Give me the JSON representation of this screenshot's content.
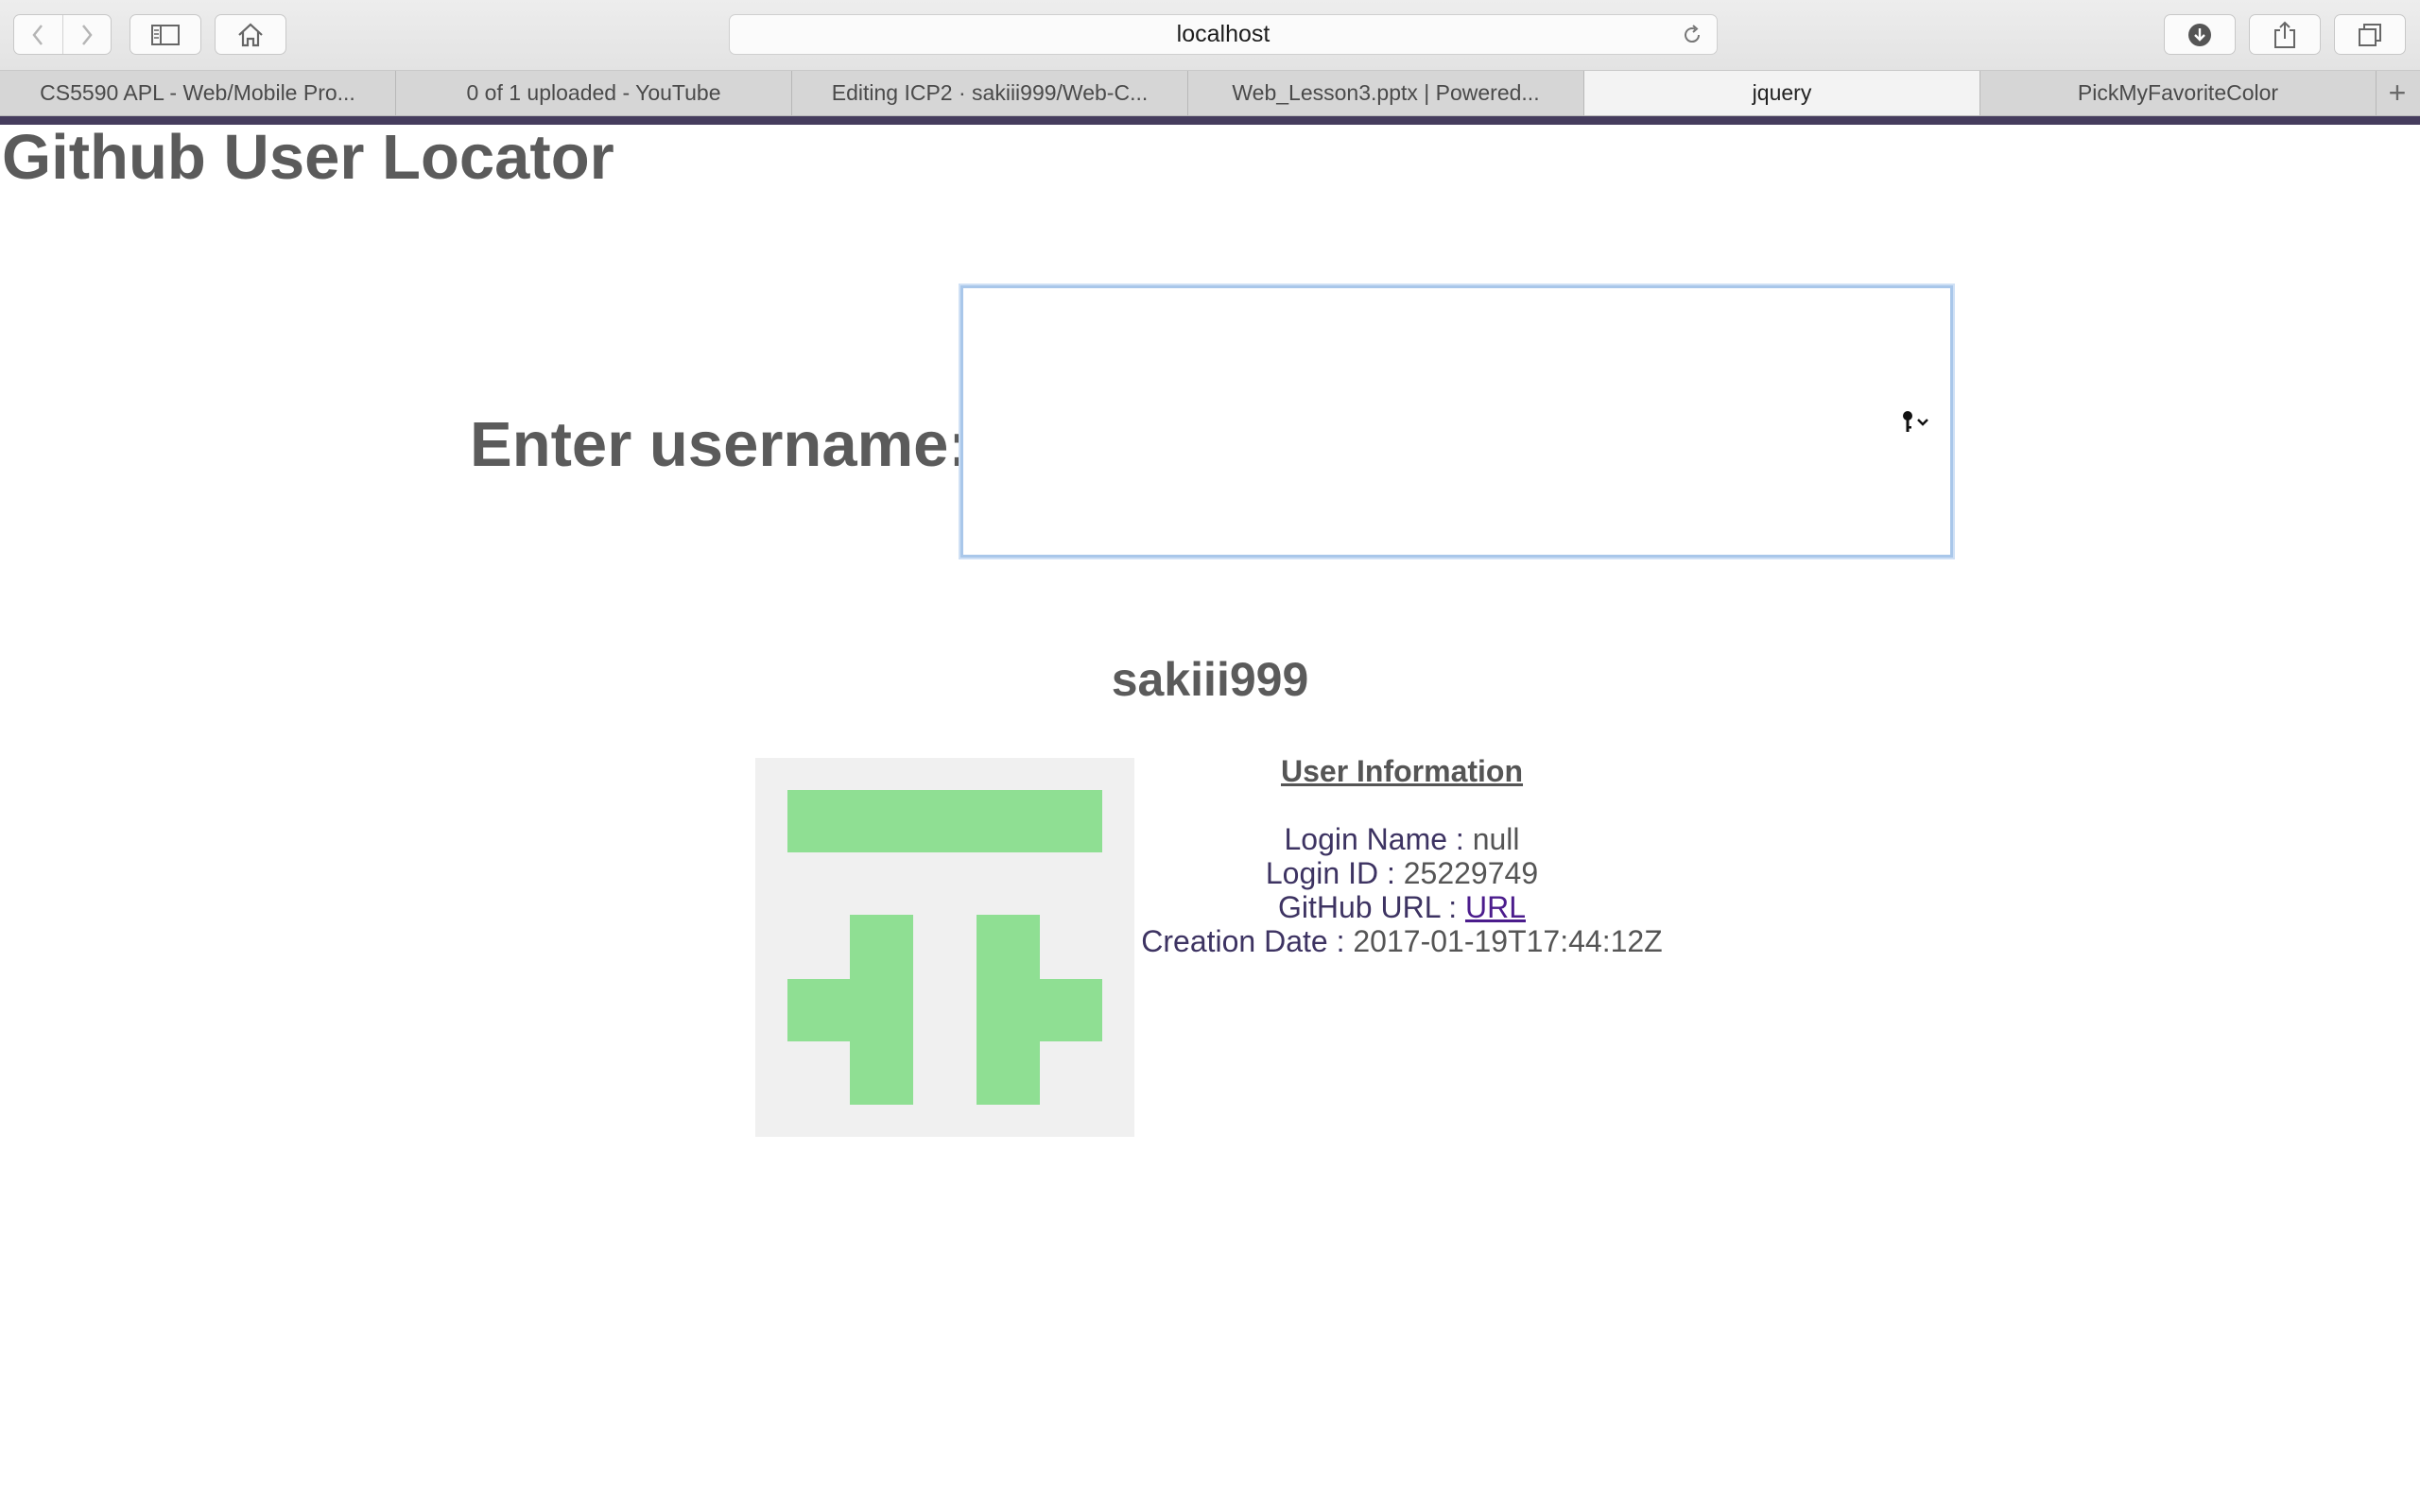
{
  "browser": {
    "address": "localhost",
    "tabs": [
      {
        "label": "CS5590 APL - Web/Mobile Pro...",
        "active": false
      },
      {
        "label": "0 of 1 uploaded - YouTube",
        "active": false
      },
      {
        "label": "Editing ICP2 · sakiii999/Web-C...",
        "active": false
      },
      {
        "label": "Web_Lesson3.pptx | Powered...",
        "active": false
      },
      {
        "label": "jquery",
        "active": true
      },
      {
        "label": "PickMyFavoriteColor",
        "active": false
      }
    ],
    "new_tab_symbol": "+",
    "accent_color": "#453c5d"
  },
  "page": {
    "title": "Github User Locator",
    "username_label": "Enter username:",
    "username_value": "",
    "login": "sakiii999",
    "avatar_colors": {
      "background": "#f0f0f0",
      "foreground": "#8fdf93"
    },
    "user_info": {
      "heading": "User Information",
      "login_name_label": "Login Name :",
      "login_name_value": "null",
      "login_id_label": "Login ID :",
      "login_id_value": "25229749",
      "github_url_label": "GitHub URL :",
      "github_url_link": "URL",
      "creation_date_label": "Creation Date :",
      "creation_date_value": "2017-01-19T17:44:12Z"
    }
  },
  "icons": {
    "back": "chevron-left-icon",
    "forward": "chevron-right-icon",
    "sidebar": "sidebar-icon",
    "home": "home-icon",
    "reload": "reload-icon",
    "download": "download-icon",
    "share": "share-icon",
    "tabs": "tabs-icon",
    "key": "key-icon"
  }
}
